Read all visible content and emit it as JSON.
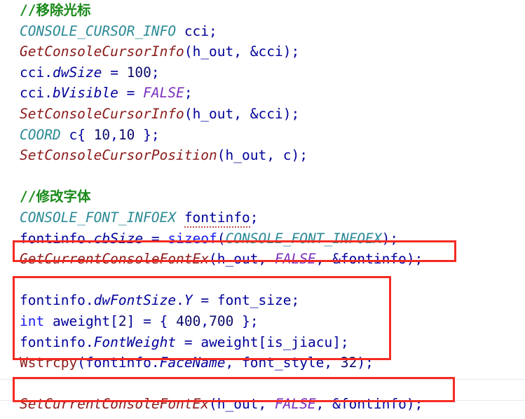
{
  "editor": {
    "language": "C++",
    "background_color": "#ffffff",
    "font_size_px": 19.5,
    "colors": {
      "comment": "#1A8A1A",
      "type": "#2B8A96",
      "function": "#8B1A1A",
      "identifier": "#00009B",
      "constant": "#7B2FBE",
      "keyword": "#1A1AEE",
      "number": "#0B0B6B",
      "annotation_box": "#F42B22",
      "guide_line": "#e8e8ef"
    }
  },
  "annotations": {
    "boxes": [
      {
        "name": "highlight-get-current-console-font-ex",
        "label": "GetCurrentConsoleFontEx(h_out, FALSE, &fontinfo);"
      },
      {
        "name": "highlight-font-config-block",
        "label": "fontinfo.dwFontSize.Y / int aweight[2] / fontinfo.FontWeight / Wstrcpy"
      },
      {
        "name": "highlight-set-current-console-font-ex",
        "label": "SetCurrentConsoleFontEx(h_out, FALSE, &fontinfo);"
      }
    ]
  },
  "code": {
    "lines": [
      {
        "n": 1,
        "text": "//移除光标",
        "tokens": [
          {
            "t": "comment",
            "v": "//移除光标"
          }
        ]
      },
      {
        "n": 2,
        "text": "CONSOLE_CURSOR_INFO cci;",
        "tokens": [
          {
            "t": "type",
            "v": "CONSOLE_CURSOR_INFO"
          },
          {
            "t": "plain",
            "v": " "
          },
          {
            "t": "ident",
            "v": "cci"
          },
          {
            "t": "punct",
            "v": ";"
          }
        ]
      },
      {
        "n": 3,
        "text": "GetConsoleCursorInfo(h_out, &cci);",
        "tokens": [
          {
            "t": "func",
            "v": "GetConsoleCursorInfo"
          },
          {
            "t": "punct",
            "v": "("
          },
          {
            "t": "ident",
            "v": "h_out"
          },
          {
            "t": "punct",
            "v": ", &"
          },
          {
            "t": "ident",
            "v": "cci"
          },
          {
            "t": "punct",
            "v": ");"
          }
        ]
      },
      {
        "n": 4,
        "text": "cci.dwSize = 100;",
        "tokens": [
          {
            "t": "ident",
            "v": "cci"
          },
          {
            "t": "punct",
            "v": "."
          },
          {
            "t": "member",
            "v": "dwSize"
          },
          {
            "t": "plain",
            "v": " "
          },
          {
            "t": "punct",
            "v": "="
          },
          {
            "t": "plain",
            "v": " "
          },
          {
            "t": "num",
            "v": "100"
          },
          {
            "t": "punct",
            "v": ";"
          }
        ]
      },
      {
        "n": 5,
        "text": "cci.bVisible = FALSE;",
        "tokens": [
          {
            "t": "ident",
            "v": "cci"
          },
          {
            "t": "punct",
            "v": "."
          },
          {
            "t": "member",
            "v": "bVisible"
          },
          {
            "t": "plain",
            "v": " "
          },
          {
            "t": "punct",
            "v": "="
          },
          {
            "t": "plain",
            "v": " "
          },
          {
            "t": "const",
            "v": "FALSE"
          },
          {
            "t": "punct",
            "v": ";"
          }
        ]
      },
      {
        "n": 6,
        "text": "SetConsoleCursorInfo(h_out, &cci);",
        "tokens": [
          {
            "t": "func",
            "v": "SetConsoleCursorInfo"
          },
          {
            "t": "punct",
            "v": "("
          },
          {
            "t": "ident",
            "v": "h_out"
          },
          {
            "t": "punct",
            "v": ", &"
          },
          {
            "t": "ident",
            "v": "cci"
          },
          {
            "t": "punct",
            "v": ");"
          }
        ]
      },
      {
        "n": 7,
        "text": "COORD c{ 10,10 };",
        "tokens": [
          {
            "t": "type",
            "v": "COORD"
          },
          {
            "t": "plain",
            "v": " "
          },
          {
            "t": "ident",
            "v": "c"
          },
          {
            "t": "punct",
            "v": "{ "
          },
          {
            "t": "num",
            "v": "10"
          },
          {
            "t": "punct",
            "v": ","
          },
          {
            "t": "num",
            "v": "10"
          },
          {
            "t": "punct",
            "v": " };"
          }
        ]
      },
      {
        "n": 8,
        "text": "SetConsoleCursorPosition(h_out, c);",
        "tokens": [
          {
            "t": "func",
            "v": "SetConsoleCursorPosition"
          },
          {
            "t": "punct",
            "v": "("
          },
          {
            "t": "ident",
            "v": "h_out"
          },
          {
            "t": "punct",
            "v": ", "
          },
          {
            "t": "ident",
            "v": "c"
          },
          {
            "t": "punct",
            "v": ");"
          }
        ]
      },
      {
        "n": 9,
        "text": "",
        "tokens": []
      },
      {
        "n": 10,
        "text": "//修改字体",
        "tokens": [
          {
            "t": "comment",
            "v": "//修改字体"
          }
        ]
      },
      {
        "n": 11,
        "text": "CONSOLE_FONT_INFOEX fontinfo;",
        "tokens": [
          {
            "t": "type",
            "v": "CONSOLE_FONT_INFOEX"
          },
          {
            "t": "plain",
            "v": " "
          },
          {
            "t": "ident-squiggle",
            "v": "fontinfo"
          },
          {
            "t": "punct",
            "v": ";"
          }
        ]
      },
      {
        "n": 12,
        "text": "fontinfo.cbSize = sizeof(CONSOLE_FONT_INFOEX);",
        "tokens": [
          {
            "t": "ident",
            "v": "fontinfo"
          },
          {
            "t": "punct",
            "v": "."
          },
          {
            "t": "member",
            "v": "cbSize"
          },
          {
            "t": "plain",
            "v": " "
          },
          {
            "t": "punct",
            "v": "="
          },
          {
            "t": "plain",
            "v": " "
          },
          {
            "t": "keyword",
            "v": "sizeof"
          },
          {
            "t": "punct",
            "v": "("
          },
          {
            "t": "type",
            "v": "CONSOLE_FONT_INFOEX"
          },
          {
            "t": "punct",
            "v": ");"
          }
        ]
      },
      {
        "n": 13,
        "text": "GetCurrentConsoleFontEx(h_out, FALSE, &fontinfo);",
        "tokens": [
          {
            "t": "func",
            "v": "GetCurrentConsoleFontEx"
          },
          {
            "t": "punct",
            "v": "("
          },
          {
            "t": "ident",
            "v": "h_out"
          },
          {
            "t": "punct",
            "v": ", "
          },
          {
            "t": "const",
            "v": "FALSE"
          },
          {
            "t": "punct",
            "v": ", &"
          },
          {
            "t": "ident",
            "v": "fontinfo"
          },
          {
            "t": "punct",
            "v": ");"
          }
        ]
      },
      {
        "n": 14,
        "text": "",
        "tokens": []
      },
      {
        "n": 15,
        "text": "fontinfo.dwFontSize.Y = font_size;",
        "tokens": [
          {
            "t": "ident",
            "v": "fontinfo"
          },
          {
            "t": "punct",
            "v": "."
          },
          {
            "t": "member",
            "v": "dwFontSize"
          },
          {
            "t": "punct",
            "v": "."
          },
          {
            "t": "member",
            "v": "Y"
          },
          {
            "t": "plain",
            "v": " "
          },
          {
            "t": "punct",
            "v": "="
          },
          {
            "t": "plain",
            "v": " "
          },
          {
            "t": "ident",
            "v": "font_size"
          },
          {
            "t": "punct",
            "v": ";"
          }
        ]
      },
      {
        "n": 16,
        "text": "int aweight[2] = { 400,700 };",
        "tokens": [
          {
            "t": "keyword",
            "v": "int"
          },
          {
            "t": "plain",
            "v": " "
          },
          {
            "t": "ident",
            "v": "aweight"
          },
          {
            "t": "punct",
            "v": "["
          },
          {
            "t": "num",
            "v": "2"
          },
          {
            "t": "punct",
            "v": "]"
          },
          {
            "t": "plain",
            "v": " "
          },
          {
            "t": "punct",
            "v": "="
          },
          {
            "t": "plain",
            "v": " "
          },
          {
            "t": "punct",
            "v": "{ "
          },
          {
            "t": "num",
            "v": "400"
          },
          {
            "t": "punct",
            "v": ","
          },
          {
            "t": "num",
            "v": "700"
          },
          {
            "t": "punct",
            "v": " };"
          }
        ]
      },
      {
        "n": 17,
        "text": "fontinfo.FontWeight = aweight[is_jiacu];",
        "tokens": [
          {
            "t": "ident",
            "v": "fontinfo"
          },
          {
            "t": "punct",
            "v": "."
          },
          {
            "t": "member",
            "v": "FontWeight"
          },
          {
            "t": "plain",
            "v": " "
          },
          {
            "t": "punct",
            "v": "="
          },
          {
            "t": "plain",
            "v": " "
          },
          {
            "t": "ident",
            "v": "aweight"
          },
          {
            "t": "punct",
            "v": "["
          },
          {
            "t": "ident",
            "v": "is_jiacu"
          },
          {
            "t": "punct",
            "v": "];"
          }
        ]
      },
      {
        "n": 18,
        "text": "Wstrcpy(fontinfo.FaceName, font_style, 32);",
        "tokens": [
          {
            "t": "func-up",
            "v": "Wstrcpy"
          },
          {
            "t": "punct",
            "v": "("
          },
          {
            "t": "ident",
            "v": "fontinfo"
          },
          {
            "t": "punct",
            "v": "."
          },
          {
            "t": "member",
            "v": "FaceName"
          },
          {
            "t": "punct",
            "v": ", "
          },
          {
            "t": "ident",
            "v": "font_style"
          },
          {
            "t": "punct",
            "v": ", "
          },
          {
            "t": "num",
            "v": "32"
          },
          {
            "t": "punct",
            "v": ");"
          }
        ]
      },
      {
        "n": 19,
        "text": "",
        "tokens": []
      },
      {
        "n": 20,
        "text": "SetCurrentConsoleFontEx(h_out, FALSE, &fontinfo);",
        "tokens": [
          {
            "t": "func",
            "v": "SetCurrentConsoleFontEx"
          },
          {
            "t": "punct",
            "v": "("
          },
          {
            "t": "ident",
            "v": "h_out"
          },
          {
            "t": "punct",
            "v": ", "
          },
          {
            "t": "const",
            "v": "FALSE"
          },
          {
            "t": "punct",
            "v": ", &"
          },
          {
            "t": "ident",
            "v": "fontinfo"
          },
          {
            "t": "punct",
            "v": ");"
          }
        ]
      }
    ]
  }
}
